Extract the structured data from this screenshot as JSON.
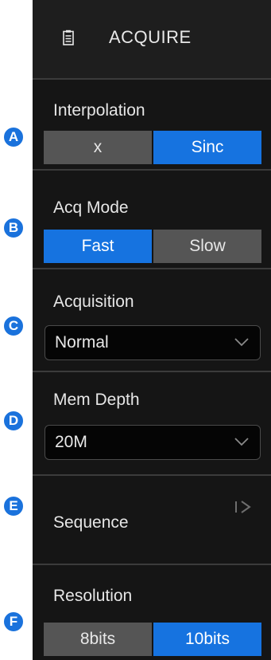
{
  "menu": {
    "title": "ACQUIRE",
    "icon": "clipboard-icon"
  },
  "interpolation": {
    "label": "Interpolation",
    "options": [
      "x",
      "Sinc"
    ],
    "selected": "Sinc"
  },
  "acq_mode": {
    "label": "Acq Mode",
    "options": [
      "Fast",
      "Slow"
    ],
    "selected": "Fast"
  },
  "acquisition": {
    "label": "Acquisition",
    "value": "Normal"
  },
  "mem_depth": {
    "label": "Mem Depth",
    "value": "20M"
  },
  "sequence": {
    "label": "Sequence",
    "icon": "sequence-arrow-icon"
  },
  "resolution": {
    "label": "Resolution",
    "options": [
      "8bits",
      "10bits"
    ],
    "selected": "10bits"
  },
  "markers": [
    "A",
    "B",
    "C",
    "D",
    "E",
    "F"
  ],
  "colors": {
    "panel_bg": "#1b1b1b",
    "section_bg": "#151515",
    "active_button": "#1673e0",
    "inactive_button": "#555555",
    "marker": "#1a72dc"
  }
}
